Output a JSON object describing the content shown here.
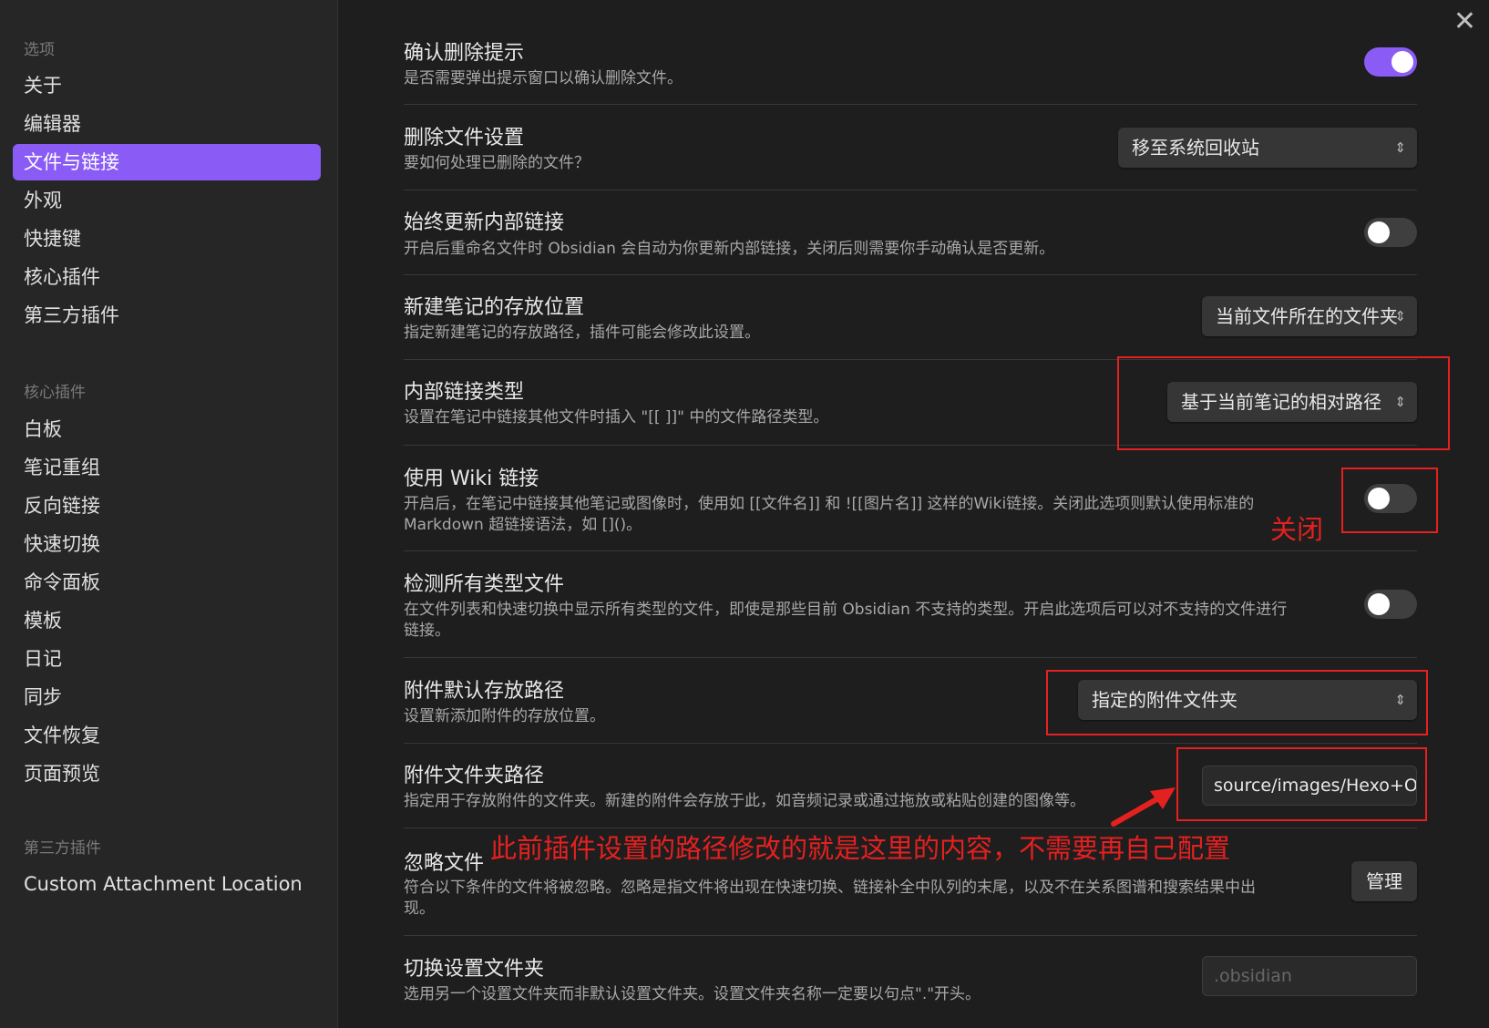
{
  "sidebar": {
    "options_title": "选项",
    "options": [
      "关于",
      "编辑器",
      "文件与链接",
      "外观",
      "快捷键",
      "核心插件",
      "第三方插件"
    ],
    "core_title": "核心插件",
    "core": [
      "白板",
      "笔记重组",
      "反向链接",
      "快速切换",
      "命令面板",
      "模板",
      "日记",
      "同步",
      "文件恢复",
      "页面预览"
    ],
    "third_title": "第三方插件",
    "third": [
      "Custom Attachment Location"
    ]
  },
  "settings": {
    "confirm_delete": {
      "name": "确认删除提示",
      "desc": "是否需要弹出提示窗口以确认删除文件。",
      "enabled": true
    },
    "deleted_files": {
      "name": "删除文件设置",
      "desc": "要如何处理已删除的文件？",
      "value": "移至系统回收站"
    },
    "update_links": {
      "name": "始终更新内部链接",
      "desc": "开启后重命名文件时 Obsidian 会自动为你更新内部链接，关闭后则需要你手动确认是否更新。",
      "enabled": false
    },
    "new_note_location": {
      "name": "新建笔记的存放位置",
      "desc": "指定新建笔记的存放路径，插件可能会修改此设置。",
      "value": "当前文件所在的文件夹"
    },
    "link_format": {
      "name": "内部链接类型",
      "desc": "设置在笔记中链接其他文件时插入 \"[[ ]]\" 中的文件路径类型。",
      "value": "基于当前笔记的相对路径"
    },
    "wiki_links": {
      "name": "使用 Wiki 链接",
      "desc1": "开启后，在笔记中链接其他笔记或图像时，使用如 [[文件名]] 和 ![[图片名]] 这样的Wiki链接。关闭此选项则默认使用标准的",
      "desc2": "Markdown 超链接语法，如 []()。",
      "enabled": false
    },
    "detect_all": {
      "name": "检测所有类型文件",
      "desc1": "在文件列表和快速切换中显示所有类型的文件，即使是那些目前 Obsidian 不支持的类型。开启此选项后可以对不支持的文件进行",
      "desc2": "链接。",
      "enabled": false
    },
    "attachment_location": {
      "name": "附件默认存放路径",
      "desc": "设置新添加附件的存放位置。",
      "value": "指定的附件文件夹"
    },
    "attachment_folder": {
      "name": "附件文件夹路径",
      "desc": "指定用于存放附件的文件夹。新建的附件会存放于此，如音频记录或通过拖放或粘贴创建的图像等。",
      "value": "source/images/Hexo+Obsidian"
    },
    "ignore_files": {
      "name": "忽略文件",
      "desc1": "符合以下条件的文件将被忽略。忽略是指文件将出现在快速切换、链接补全中队列的末尾，以及不在关系图谱和搜索结果中出",
      "desc2": "现。",
      "button": "管理"
    },
    "config_folder": {
      "name": "切换设置文件夹",
      "desc": "选用另一个设置文件夹而非默认设置文件夹。设置文件夹名称一定要以句点\".\"开头。",
      "placeholder": ".obsidian"
    }
  },
  "annotations": {
    "off_label": "关闭",
    "note": "此前插件设置的路径修改的就是这里的内容，不需要再自己配置"
  },
  "icons": {
    "close": "close-icon",
    "chevron": "chevron-up-down-icon"
  },
  "colors": {
    "accent": "#8a5cf5",
    "annotation": "#e52020"
  }
}
